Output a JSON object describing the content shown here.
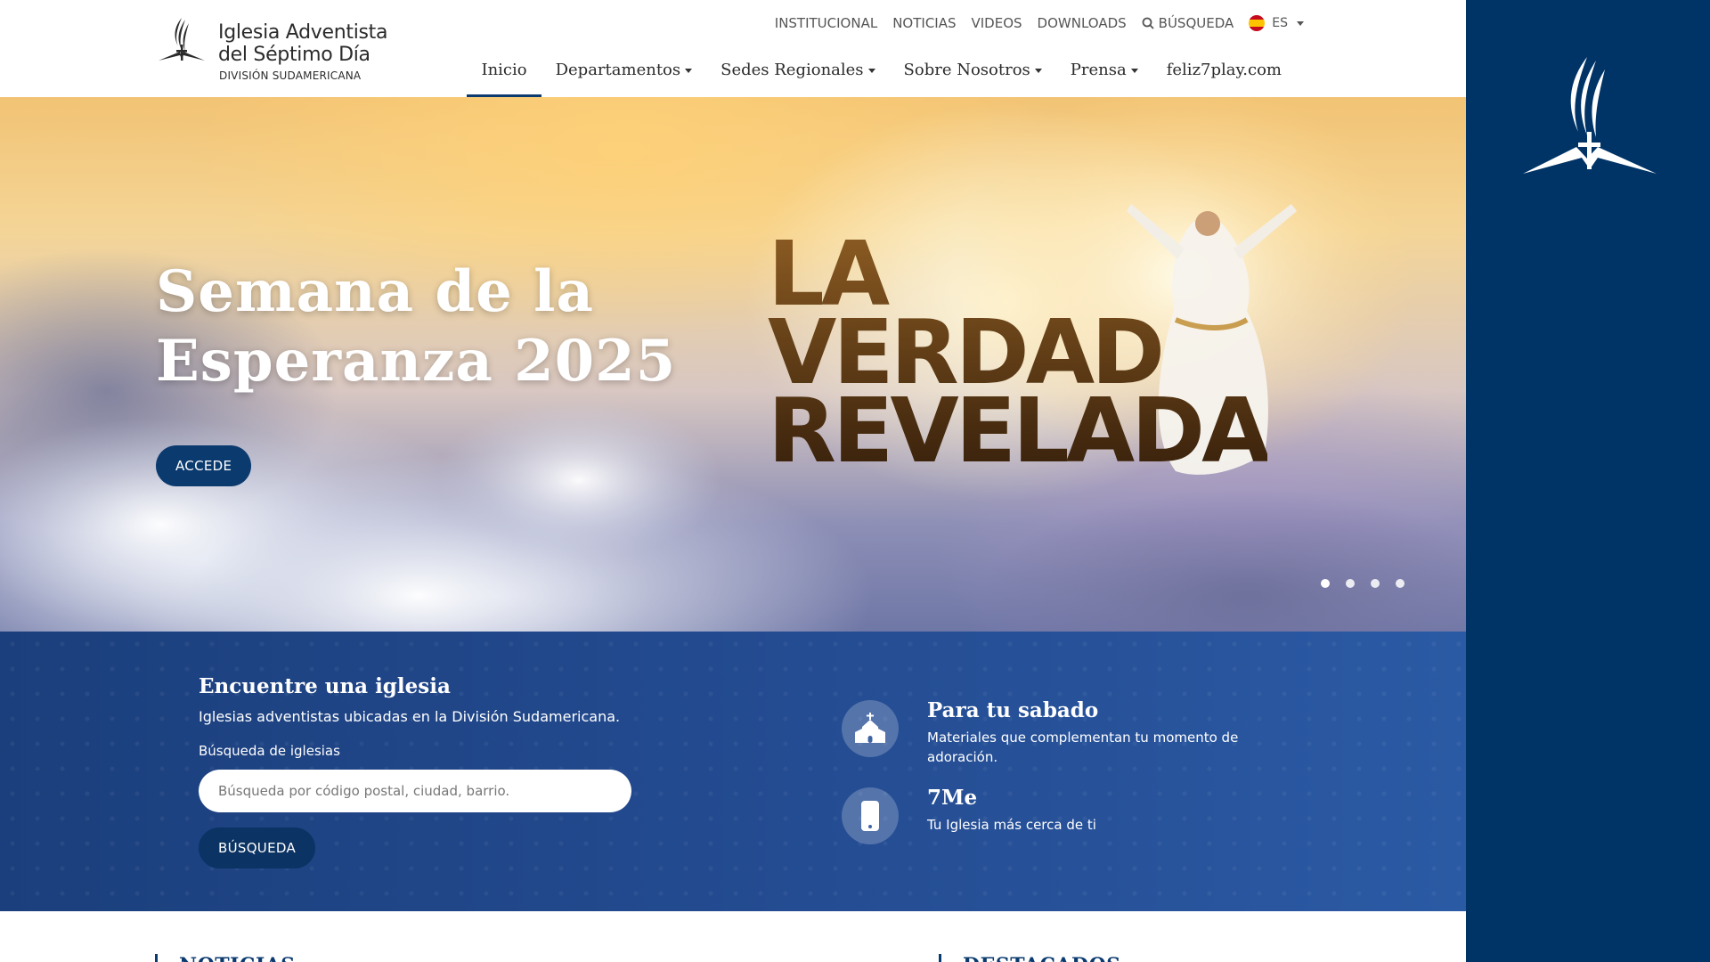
{
  "brand": {
    "line1": "Iglesia Adventista",
    "line2": "del Séptimo Día",
    "line3": "DIVISIÓN SUDAMERICANA"
  },
  "util_nav": {
    "items": [
      "INSTITUCIONAL",
      "NOTICIAS",
      "VIDEOS",
      "DOWNLOADS"
    ],
    "search_label": "BÚSQUEDA",
    "lang": "ES"
  },
  "main_nav": [
    {
      "label": "Inicio",
      "dropdown": false,
      "active": true
    },
    {
      "label": "Departamentos",
      "dropdown": true,
      "active": false
    },
    {
      "label": "Sedes Regionales",
      "dropdown": true,
      "active": false
    },
    {
      "label": "Sobre Nosotros",
      "dropdown": true,
      "active": false
    },
    {
      "label": "Prensa",
      "dropdown": true,
      "active": false
    },
    {
      "label": "feliz7play.com",
      "dropdown": false,
      "active": false
    }
  ],
  "hero": {
    "title_line1": "Semana de la",
    "title_line2": "Esperanza 2025",
    "button": "ACCEDE",
    "art_line1": "LA",
    "art_line2": "VERDAD",
    "art_line3": "REVELADA",
    "slides": 4,
    "active_slide": 1
  },
  "finder": {
    "title": "Encuentre una iglesia",
    "subtitle": "Iglesias adventistas ubicadas en la División Sudamericana.",
    "label": "Búsqueda de iglesias",
    "placeholder": "Búsqueda por código postal, ciudad, barrio.",
    "button": "BÚSQUEDA"
  },
  "features": [
    {
      "icon": "church-icon",
      "title": "Para tu sabado",
      "desc": "Materiales que complementan tu momento de adoración."
    },
    {
      "icon": "smartphone-icon",
      "title": "7Me",
      "desc": "Tu Iglesia más cerca de ti"
    }
  ],
  "sections": {
    "left": "NOTICIAS",
    "right": "DESTACADOS"
  },
  "colors": {
    "brand_dark": "#003366",
    "accent": "#0b3a6f",
    "finder_bg": "#244c92"
  }
}
